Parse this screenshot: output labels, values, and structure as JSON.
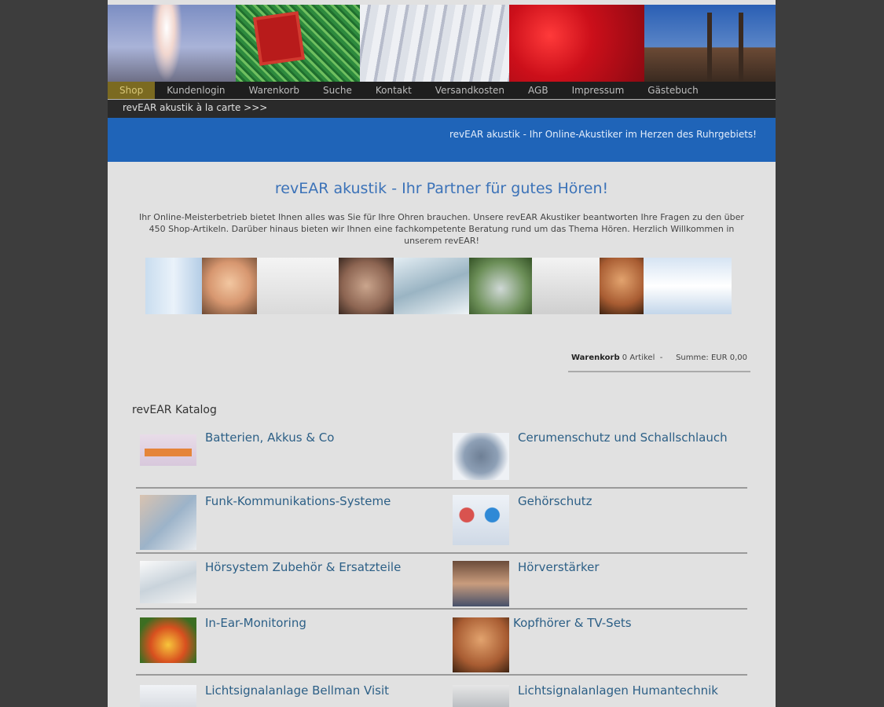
{
  "nav": {
    "items": [
      "Shop",
      "Kundenlogin",
      "Warenkorb",
      "Suche",
      "Kontakt",
      "Versandkosten",
      "AGB",
      "Impressum",
      "Gästebuch"
    ],
    "active_index": 0
  },
  "subnav": {
    "link": "revEAR akustik à la carte >>>"
  },
  "banner_tagline": "revEAR akustik - Ihr Online-Akustiker im Herzen des Ruhrgebiets!",
  "headline": "revEAR akustik - Ihr Partner für gutes Hören!",
  "intro": "Ihr Online-Meisterbetrieb bietet Ihnen alles was Sie für Ihre Ohren brauchen. Unsere revEAR Akustiker beantworten Ihre Fragen zu den über 450 Shop-Artikeln. Darüber hinaus bieten wir Ihnen eine fachkompetente Beratung rund um das Thema Hören. Herzlich Willkommen in unserem revEAR!",
  "cart": {
    "label": "Warenkorb",
    "count_text": "0 Artikel",
    "separator": "-",
    "sum_label": "Summe:",
    "sum_value": "EUR 0,00"
  },
  "catalog": {
    "title": "revEAR Katalog",
    "categories": [
      "Batterien, Akkus & Co",
      "Cerumenschutz und Schallschlauch",
      "Funk-Kommunikations-Systeme",
      "Gehörschutz",
      "Hörsystem Zubehör & Ersatzteile",
      "Hörverstärker",
      "In-Ear-Monitoring",
      "Kopfhörer & TV-Sets",
      "Lichtsignalanlage Bellman Visit",
      "Lichtsignalanlagen Humantechnik"
    ]
  },
  "colors": {
    "accent_blue": "#1f64b8",
    "nav_active": "#7b6a21",
    "link": "#2c5f86"
  }
}
